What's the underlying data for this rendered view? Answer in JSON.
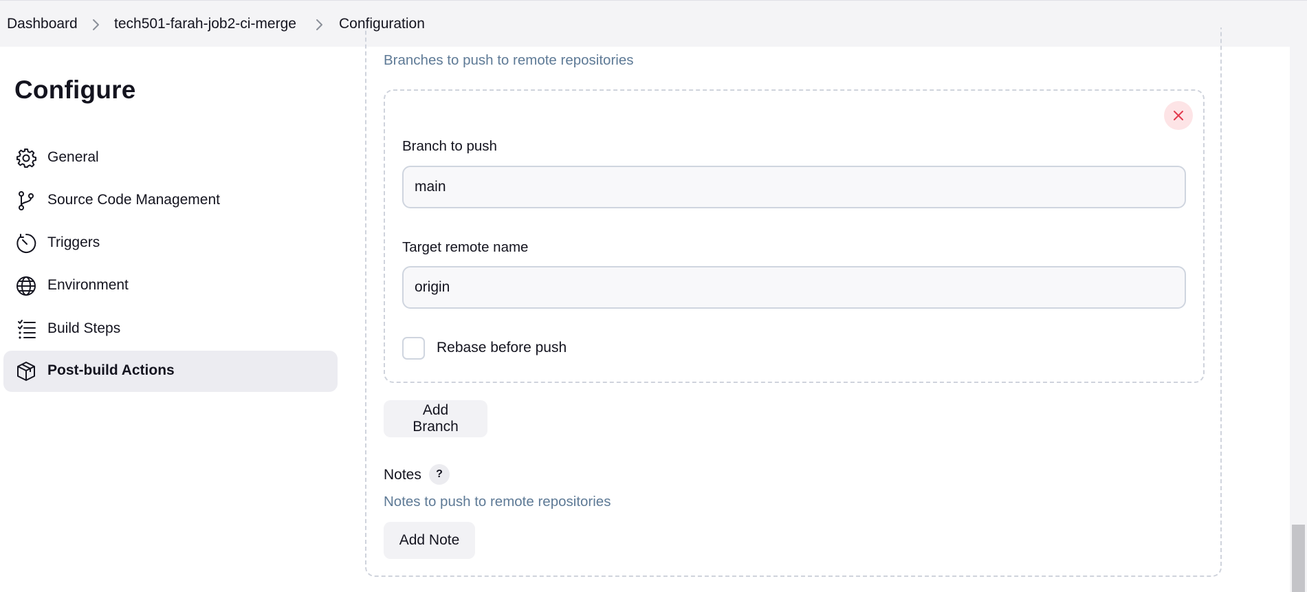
{
  "breadcrumb": {
    "items": [
      "Dashboard",
      "tech501-farah-job2-ci-merge",
      "Configuration"
    ]
  },
  "sidebar": {
    "title": "Configure",
    "items": [
      {
        "label": "General",
        "icon": "gear-icon"
      },
      {
        "label": "Source Code Management",
        "icon": "git-branch-icon"
      },
      {
        "label": "Triggers",
        "icon": "clock-icon"
      },
      {
        "label": "Environment",
        "icon": "globe-icon"
      },
      {
        "label": "Build Steps",
        "icon": "list-icon"
      },
      {
        "label": "Post-build Actions",
        "icon": "package-icon",
        "active": true
      }
    ]
  },
  "branches": {
    "description": "Branches to push to remote repositories",
    "branch_to_push_label": "Branch to push",
    "branch_to_push_value": "main",
    "target_remote_label": "Target remote name",
    "target_remote_value": "origin",
    "rebase_label": "Rebase before push",
    "rebase_checked": false,
    "add_branch_label": "Add Branch"
  },
  "notes": {
    "label": "Notes",
    "help": "?",
    "description": "Notes to push to remote repositories",
    "add_note_label": "Add Note"
  },
  "colors": {
    "accent_close": "#e23a4e",
    "description_text": "#5e7a96",
    "active_nav_bg": "#ececf1"
  }
}
